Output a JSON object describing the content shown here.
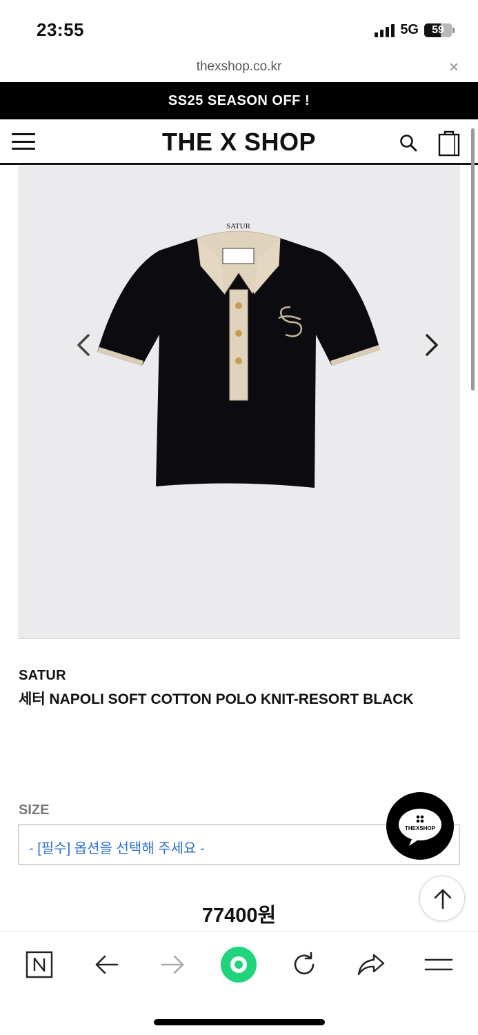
{
  "status_bar": {
    "time": "23:55",
    "network": "5G",
    "battery": "59"
  },
  "browser": {
    "url": "thexshop.co.kr",
    "close_glyph": "×"
  },
  "promo": {
    "text": "SS25 SEASON OFF !"
  },
  "header": {
    "logo": "THE X SHOP",
    "icons": [
      "menu-icon",
      "search-icon",
      "shopping-bag-icon"
    ]
  },
  "product": {
    "image_label": "SATUR",
    "brand": "SATUR",
    "name": "세터 NAPOLI SOFT COTTON POLO KNIT-RESORT BLACK",
    "size_label": "SIZE",
    "size_placeholder": "- [필수] 옵션을 선택해 주세요 -",
    "price": "77400원"
  },
  "chat": {
    "label": "THEXSHOP"
  },
  "toolbar": {
    "items": [
      "naver-icon",
      "back-icon",
      "forward-icon",
      "green-dot-icon",
      "reload-icon",
      "share-icon",
      "menu-icon"
    ]
  },
  "colors": {
    "accent_blue": "#2a6ec6",
    "naver_green": "#1fd47a",
    "promo_bg": "#000000",
    "image_bg": "#ebebed"
  }
}
